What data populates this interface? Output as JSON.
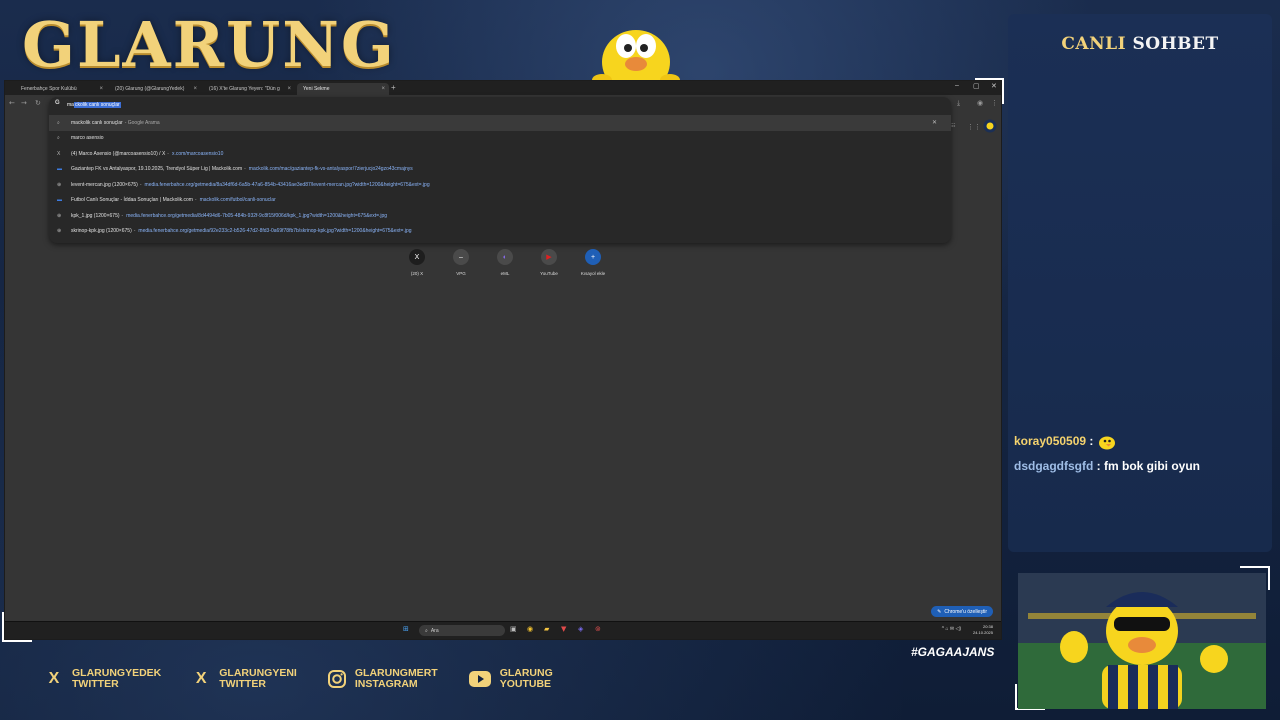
{
  "overlay": {
    "logo_text": "GLARUNG",
    "hashtag": "#GAGAAJANS",
    "socials": [
      {
        "line1": "GLARUNGYEDEK",
        "line2": "TWITTER",
        "icon": "x-icon"
      },
      {
        "line1": "GLARUNGYENI",
        "line2": "TWITTER",
        "icon": "x-icon"
      },
      {
        "line1": "GLARUNGMERT",
        "line2": "INSTAGRAM",
        "icon": "instagram-icon"
      },
      {
        "line1": "GLARUNG",
        "line2": "YOUTUBE",
        "icon": "youtube-icon"
      }
    ],
    "accent_color": "#f2d27a"
  },
  "chat": {
    "title_first": "CANLI",
    "title_rest": "SOHBET",
    "messages": [
      {
        "user": "koray050509",
        "sep": " : ",
        "text": ""
      },
      {
        "user": "dsdgagdfsgfd",
        "sep": " : ",
        "text": "fm bok gibi oyun"
      }
    ]
  },
  "browser": {
    "tabs": [
      {
        "label": "Fenerbahçe Spor Kulübü",
        "close": "×"
      },
      {
        "label": "(20) Glarung (@GlarungYedek)",
        "close": "×"
      },
      {
        "label": "(16) X'te Glarung Yeyen: \"Dün g",
        "close": "×"
      },
      {
        "label": "Yeni Sekme",
        "close": "×"
      }
    ],
    "new_tab": "+",
    "omnibox": {
      "typed": "ma",
      "completion": "ckolik canlı sonuçlar"
    },
    "suggestions": [
      {
        "icon": "search-icon",
        "glyph": "⌕",
        "title": "mackolik canlı sonuçlar",
        "dim": "- Google Arama",
        "url": ""
      },
      {
        "icon": "search-icon",
        "glyph": "⌕",
        "title": "marco asensio",
        "dim": "",
        "url": ""
      },
      {
        "icon": "x-icon",
        "glyph": "X",
        "title": "(4) Marco Asensio (@marcoasensio10) / X",
        "dim": "-",
        "url": "x.com/marcoasensio10"
      },
      {
        "icon": "mackolik-icon",
        "glyph": "▬",
        "title": "Gaziantep FK vs Antalyaspor, 19.10.2025, Trendyol Süper Lig | Mackolik.com",
        "dim": "-",
        "url": "mackolik.com/mac/gaziantep-fk-vs-antalyaspor/7zierjucjo24gzo43cmajnys"
      },
      {
        "icon": "globe-icon",
        "glyph": "⊕",
        "title": "levent-mercan.jpg (1200×675)",
        "dim": "-",
        "url": "media.fenerbahce.org/getmedia/8a34df6d-6a5b-47a6-854b-43416ae3ed87/levent-mercan.jpg?width=1200&height=675&ext=.jpg"
      },
      {
        "icon": "mackolik-icon",
        "glyph": "▬",
        "title": "Futbol Canlı Sonuçlar - İddaa Sonuçları | Mackolik.com",
        "dim": "-",
        "url": "mackolik.com/futbol/canli-sonuclar"
      },
      {
        "icon": "globe-icon",
        "glyph": "⊕",
        "title": "kpk_1.jpg (1200×675)",
        "dim": "-",
        "url": "media.fenerbahce.org/getmedia/8d4494d6-7b05-484b-932f-9c8f15f006d/kpk_1.jpg?width=1200&height=675&ext=.jpg"
      },
      {
        "icon": "globe-icon",
        "glyph": "⊕",
        "title": "skrinop-kpk.jpg (1200×675)",
        "dim": "-",
        "url": "media.fenerbahce.org/getmedia/92e233c2-b526-47d2-8fd3-0a69f78fb7b/skrinop-kpk.jpg?width=1200&height=675&ext=.jpg"
      }
    ],
    "shortcuts": [
      {
        "label": "(20) X",
        "glyph": "X",
        "color": "#1e1e1e"
      },
      {
        "label": "VPG",
        "glyph": "–",
        "color": "#4a4a4a"
      },
      {
        "label": "eML",
        "glyph": "◐",
        "color": "#4a4a4a"
      },
      {
        "label": "YouTube",
        "glyph": "▶",
        "color": "#e02020"
      },
      {
        "label": "Kısayol ekle",
        "glyph": "+",
        "color": "#1f5fb6"
      }
    ],
    "customize_label": "Chrome'u özelleştir"
  },
  "taskbar": {
    "search_label": "Ara",
    "time": "20:38",
    "date": "24.10.2025",
    "tray": "^  ⌂  ✉  ◁)"
  }
}
